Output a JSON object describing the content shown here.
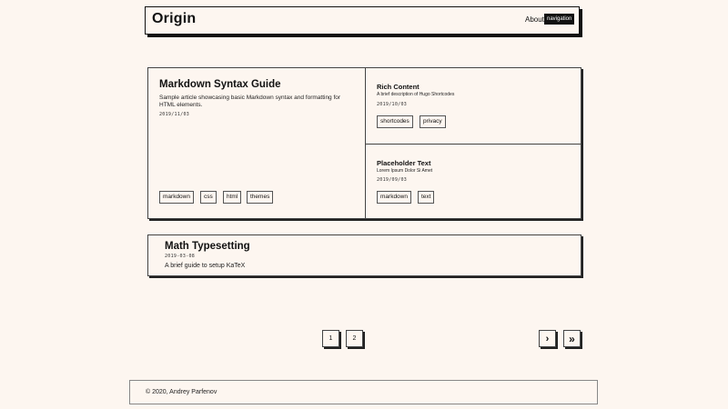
{
  "header": {
    "title": "Origin",
    "about_label": "About",
    "nav_button_label": "navigation"
  },
  "featured": {
    "title": "Markdown Syntax Guide",
    "description": "Sample article showcasing basic Markdown syntax and formatting for HTML elements.",
    "date": "2019/11/03",
    "tags": [
      "markdown",
      "css",
      "html",
      "themes"
    ]
  },
  "rich_content": {
    "title": "Rich Content",
    "description": "A brief description of Hugo Shortcodes",
    "date": "2019/10/03",
    "tags": [
      "shortcodes",
      "privacy"
    ]
  },
  "placeholder": {
    "title": "Placeholder Text",
    "description": "Lorem Ipsum Dolor Si Amet",
    "date": "2019/09/03",
    "tags": [
      "markdown",
      "text"
    ]
  },
  "math": {
    "title": "Math Typesetting",
    "date": "2019-03-08",
    "description": "A brief guide to setup KaTeX"
  },
  "pagination": {
    "pages": [
      "1",
      "2"
    ],
    "next": "›",
    "last": "»"
  },
  "footer": {
    "text": "© 2020, Andrey Parfenov"
  }
}
